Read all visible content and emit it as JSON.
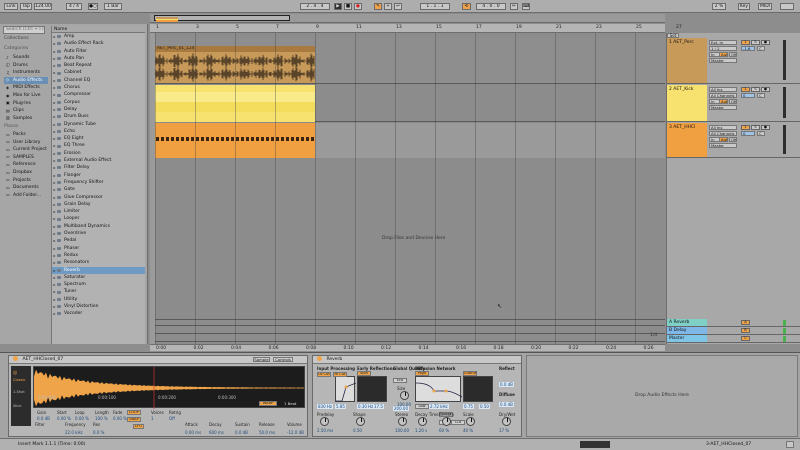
{
  "transport": {
    "link": "Link",
    "tap": "Tap",
    "tempo": "124.00",
    "time_sig": "4 / 4",
    "metronome": "●○",
    "quantize": "1 Bar",
    "position": "2 . 4 . 4",
    "loop_start": "1 . 1 . 1",
    "loop_length": "4 . 0 . 0",
    "cpu": "2 %",
    "key": "Key",
    "midi": "MIDI"
  },
  "browser": {
    "search_placeholder": "Search (Ctrl + F)",
    "collections_label": "Collections",
    "categories_label": "Categories",
    "categories": [
      "Sounds",
      "Drums",
      "Instruments",
      "Audio Effects",
      "MIDI Effects",
      "Max for Live",
      "Plug-Ins",
      "Clips",
      "Samples"
    ],
    "category_selected": "Audio Effects",
    "places_label": "Places",
    "places": [
      "Packs",
      "User Library",
      "Current Project",
      "SAMPLES",
      "Reference",
      "Dropbox",
      "Projects",
      "Documents",
      "Add Folder..."
    ],
    "name_header": "Name",
    "items": [
      "Amp",
      "Audio Effect Rack",
      "Auto Filter",
      "Auto Pan",
      "Beat Repeat",
      "Cabinet",
      "Channel EQ",
      "Chorus",
      "Compressor",
      "Corpus",
      "Delay",
      "Drum Buss",
      "Dynamic Tube",
      "Echo",
      "EQ Eight",
      "EQ Three",
      "Erosion",
      "External Audio Effect",
      "Filter Delay",
      "Flanger",
      "Frequency Shifter",
      "Gate",
      "Glue Compressor",
      "Grain Delay",
      "Limiter",
      "Looper",
      "Multiband Dynamics",
      "Overdrive",
      "Pedal",
      "Phaser",
      "Redux",
      "Resonators",
      "Reverb",
      "Saturator",
      "Spectrum",
      "Tuner",
      "Utility",
      "Vinyl Distortion",
      "Vocoder"
    ],
    "item_selected": "Reverb"
  },
  "ruler": {
    "bars": [
      "1",
      "3",
      "5",
      "7",
      "9",
      "11",
      "13",
      "15",
      "17",
      "19",
      "21",
      "23",
      "25",
      "27"
    ]
  },
  "time_ruler": {
    "marks": [
      "0:00",
      "0:02",
      "0:04",
      "0:06",
      "0:08",
      "0:10",
      "0:12",
      "0:14",
      "0:16",
      "0:18",
      "0:20",
      "0:22",
      "0:24",
      "0:26"
    ]
  },
  "arrangement": {
    "clip_label": "AET_Perc_01_124",
    "drop_message": "Drop Files and Devices Here",
    "page_indicator": "1/4"
  },
  "tracks": [
    {
      "name": "1 AET_Perc",
      "color": "#c89a5a",
      "input": "Ext. In",
      "channel": "1 / 2",
      "output": "Master",
      "vol": "-1.6",
      "pan": "C"
    },
    {
      "name": "2 AET_Kick",
      "color": "#f7e270",
      "input": "All Ins",
      "channel": "All Channels",
      "output": "Master",
      "vol": "0",
      "pan": "C"
    },
    {
      "name": "3 AET_HHCl",
      "color": "#f0a040",
      "input": "All Ins",
      "channel": "All Channels",
      "output": "Master",
      "vol": "0",
      "pan": "C"
    }
  ],
  "returns": [
    {
      "name": "A Reverb",
      "color": "#7fd0c6"
    },
    {
      "name": "B Delay",
      "color": "#7fb8e8"
    },
    {
      "name": "Master",
      "color": "#7fc5e8"
    }
  ],
  "mixer_labels": {
    "in": "In",
    "auto": "Auto",
    "off": "Off",
    "set": "Set"
  },
  "sampler": {
    "title": "AET_HHClosed_07",
    "tabs": [
      "Sample",
      "Controls"
    ],
    "labels": [
      "Gain",
      "Start",
      "Loop",
      "Length",
      "Fade",
      "Voices",
      "Retrig"
    ],
    "values": [
      "0.0 dB",
      "0.00 %",
      "0.00 %",
      "100 %",
      "0.00 %",
      "1",
      "Off"
    ],
    "bottom_labels": [
      "Filter",
      "Frequency",
      "Res",
      "Attack",
      "Decay",
      "Sustain",
      "Release",
      "Volume"
    ],
    "bottom_values": [
      "22.0 kHz",
      "0.0 %",
      "0.00 ms",
      "600 ms",
      "0.0 dB",
      "50.0 ms",
      "-12.0 dB"
    ],
    "time_labels": [
      "0:00:000",
      "0:00:100",
      "0:00:200",
      "0:00:300"
    ],
    "warp": "WARP",
    "beat_label": "1 Beat",
    "classic": "Classic",
    "one_shot": "1-Shot",
    "slice": "Slice",
    "lfo": "LFO",
    "loop": "LOOP",
    "snap": "SNAP"
  },
  "reverb": {
    "title": "Reverb",
    "sections": [
      "Input Processing",
      "Early Reflections",
      "Global Quality",
      "Diffusion Network",
      "Reflect",
      "Diffuse"
    ],
    "buttons": [
      "Lo Cut",
      "Hi Cut",
      "Spin",
      "Eco",
      "High",
      "Low",
      "Chorus",
      "Freeze",
      "Flat",
      "Cut"
    ],
    "values": [
      "830 Hz",
      "5.85",
      "0.30 Hz",
      "17.5",
      "200.00",
      "2.72 kHz",
      "0.75",
      "0.50",
      "0.0 dB",
      "0.0 dB"
    ],
    "knob_labels": [
      "Predelay",
      "Shape",
      "Stereo",
      "Decay Time",
      "Density",
      "Scale",
      "Dry/Wet",
      "Size"
    ],
    "knob_values": [
      "2.50 ms",
      "0.50",
      "100.00",
      "1.20 s",
      "60 %",
      "40 %",
      "17 %",
      "100.00"
    ]
  },
  "device_drop": "Drop Audio Effects Here",
  "status": {
    "message": "Insert Mark 1.1.1 (Time: 0:00)",
    "track_label": "3-AET_HHClosed_07"
  }
}
